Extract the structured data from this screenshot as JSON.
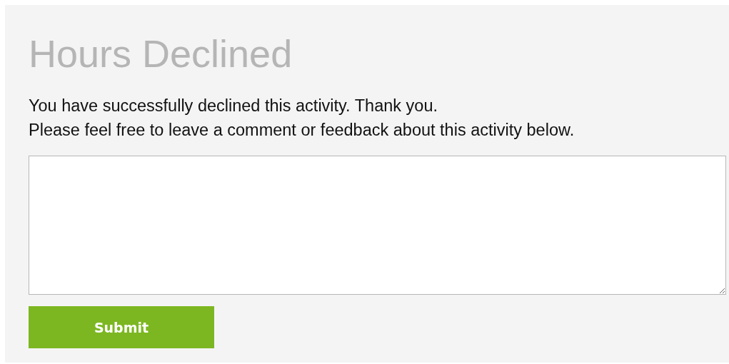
{
  "title": "Hours Declined",
  "messages": [
    "You have successfully declined this activity. Thank you.",
    "Please feel free to leave a comment or feedback about this activity below."
  ],
  "submit": {
    "label": "Submit"
  }
}
